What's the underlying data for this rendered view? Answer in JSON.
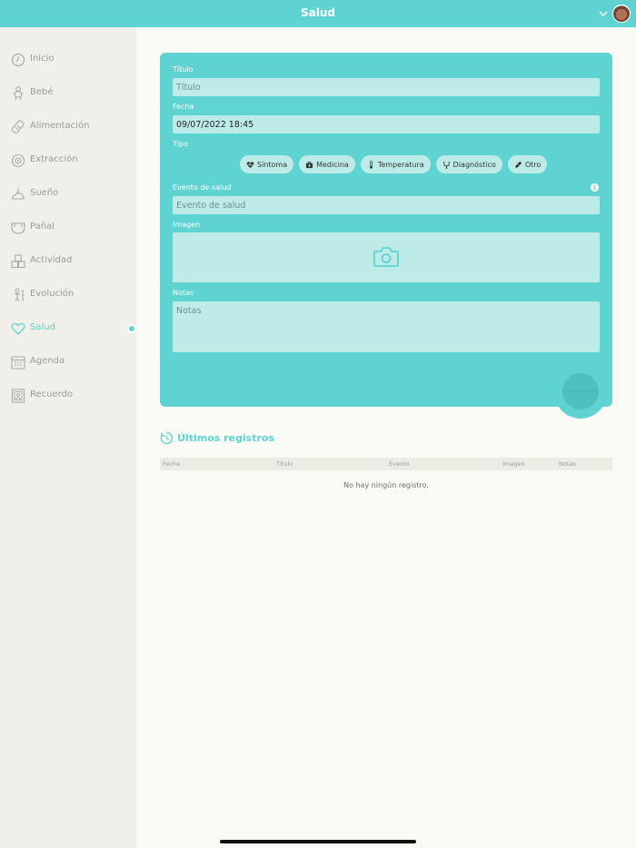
{
  "header": {
    "title": "Salud"
  },
  "sidebar": {
    "items": [
      {
        "label": "Inicio",
        "icon": "clock-icon"
      },
      {
        "label": "Bebé",
        "icon": "baby-icon"
      },
      {
        "label": "Alimentación",
        "icon": "bottle-icon"
      },
      {
        "label": "Extracción",
        "icon": "pump-icon"
      },
      {
        "label": "Sueño",
        "icon": "moon-cloud-icon"
      },
      {
        "label": "Pañal",
        "icon": "diaper-icon"
      },
      {
        "label": "Actividad",
        "icon": "blocks-icon"
      },
      {
        "label": "Evolución",
        "icon": "growth-icon"
      },
      {
        "label": "Salud",
        "icon": "heart-icon",
        "active": true
      },
      {
        "label": "Agenda",
        "icon": "calendar-icon"
      },
      {
        "label": "Recuerdo",
        "icon": "frame-icon"
      }
    ]
  },
  "form": {
    "title_label": "Título",
    "title_placeholder": "Título",
    "date_label": "Fecha",
    "date_value": "09/07/2022 18:45",
    "type_label": "Tipo",
    "types": [
      {
        "label": "Síntoma",
        "icon": "heart-pulse-icon"
      },
      {
        "label": "Medicina",
        "icon": "medkit-icon"
      },
      {
        "label": "Temperatura",
        "icon": "thermometer-icon"
      },
      {
        "label": "Diagnóstico",
        "icon": "stethoscope-icon"
      },
      {
        "label": "Otro",
        "icon": "bandage-icon"
      }
    ],
    "event_label": "Evento de salud",
    "event_placeholder": "Evento de salud",
    "image_label": "Imagen",
    "notes_label": "Notas",
    "notes_placeholder": "Notas"
  },
  "recent": {
    "title": "Últimos registros",
    "columns": [
      "Fecha",
      "Título",
      "Evento",
      "Imagen",
      "Notas"
    ],
    "empty_message": "No hay ningún registro."
  },
  "colors": {
    "accent": "#5fd3d2",
    "field": "#bdebe8",
    "sidebar": "#f0efe9"
  }
}
